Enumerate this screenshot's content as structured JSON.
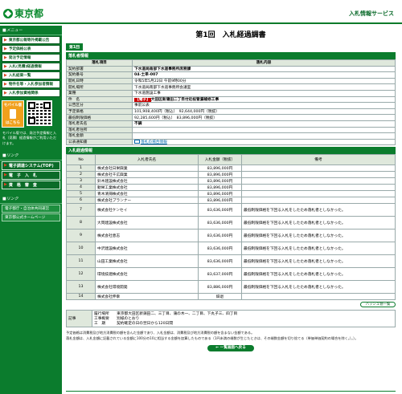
{
  "header": {
    "logo_text": "東京都",
    "service": "入札情報サービス"
  },
  "sidebar": {
    "menu_head": "■メニュー",
    "items": [
      "東京都公報等外掲載公告",
      "予定価格公表",
      "発注予定情報",
      "入札(見積)経過情報",
      "入札結果一覧",
      "物件名等・入札参加者情報",
      "入札参加資格関係"
    ],
    "mobile_label": "モバイル版",
    "mobile_sub": "はこちら",
    "mobile_note": "モバイル版では、発注予定情報と入札（見積）経過情報がご利用いただけます。",
    "link_head": "■リンク",
    "big_items": [
      "電子調達システム(TOP)",
      "電　子　入　札",
      "資　格　審　査"
    ],
    "ext_head": "■リンク",
    "ext_links": [
      "電子都庁・自治体共同運営",
      "東京都公式ホームページ"
    ]
  },
  "page": {
    "title": "第1回　入札経過調書",
    "round_tab": "第1回"
  },
  "info": {
    "section": "落札者情報",
    "col_item": "落札項目",
    "col_content": "落札内容",
    "rows": [
      {
        "label": "契約部署",
        "value": "下水道局南部下水道事務所庶務課",
        "bold": true
      },
      {
        "label": "契約番号",
        "value": "04-土単-007",
        "bold": true
      },
      {
        "label": "開札日時",
        "value": "令和5年5月22日 午前9時00分"
      },
      {
        "label": "開札場所",
        "value": "下水道局南部下水道事務所会議室"
      },
      {
        "label": "業種",
        "value": "下水道施設工事"
      },
      {
        "label": "件　名",
        "tag": "【電子】",
        "value": "大田区新蒲田二丁目付近枝管漏補修工事",
        "bold": true
      },
      {
        "label": "公告区分",
        "value": "事前公表"
      },
      {
        "label": "予定価格",
        "value": "101,908,400円（税込）　92,644,000円（税抜）"
      },
      {
        "label": "最低制限価格",
        "value": "92,285,600円（税込）　83,896,000円（税抜）"
      },
      {
        "label": "落札者氏名",
        "value": "不調",
        "bold": true
      },
      {
        "label": "落札者住所",
        "value": ""
      },
      {
        "label": "落札金額",
        "value": ""
      },
      {
        "label": "公表通知書",
        "value": "落札の場合情報",
        "link": true
      }
    ]
  },
  "result": {
    "section": "入札経過情報",
    "col_no": "No",
    "col_name": "入札者氏名",
    "col_amount": "入札金額（税抜）",
    "col_note": "備考",
    "rows": [
      {
        "no": "1",
        "name": "株式会社日栄興業",
        "amount": "83,896,000円",
        "note": ""
      },
      {
        "no": "2",
        "name": "株式会社千広興業",
        "amount": "83,896,000円",
        "note": ""
      },
      {
        "no": "3",
        "name": "鈴木建設株式会社",
        "amount": "83,896,000円",
        "note": ""
      },
      {
        "no": "4",
        "name": "動栄工業株式会社",
        "amount": "83,896,000円",
        "note": ""
      },
      {
        "no": "5",
        "name": "青木清掃株式会社",
        "amount": "83,896,000円",
        "note": ""
      },
      {
        "no": "6",
        "name": "株式会社プランナー",
        "amount": "83,896,000円",
        "note": ""
      },
      {
        "no": "7",
        "name": "株式会社ケンセイ",
        "amount": "83,636,000円",
        "note": "最低制限価格を下回る入札をしたため落札者としなかった。",
        "tall": true
      },
      {
        "no": "8",
        "name": "大岡建設株式会社",
        "amount": "83,636,000円",
        "note": "最低制限価格を下回る入札をしたため落札者としなかった。",
        "tall": true
      },
      {
        "no": "9",
        "name": "株式会社恵志",
        "amount": "83,636,000円",
        "note": "最低制限価格を下回る入札をしたため落札者としなかった。",
        "tall": true
      },
      {
        "no": "10",
        "name": "中沢建設株式会社",
        "amount": "83,636,000円",
        "note": "最低制限価格を下回る入札をしたため落札者としなかった。",
        "tall": true
      },
      {
        "no": "11",
        "name": "山田工業株式会社",
        "amount": "83,636,000円",
        "note": "最低制限価格を下回る入札をしたため落札者としなかった。",
        "tall": true
      },
      {
        "no": "12",
        "name": "環境技建株式会社",
        "amount": "83,637,000円",
        "note": "最低制限価格を下回る入札をしたため落札者としなかった。",
        "tall": true
      },
      {
        "no": "13",
        "name": "株式会社環境開発",
        "amount": "83,886,000円",
        "note": "最低制限価格を下回る入札をしたため落札者としなかった。",
        "tall": true
      },
      {
        "no": "14",
        "name": "株式会社伸幸",
        "amount": "辞退",
        "note": ""
      }
    ]
  },
  "ext_button": "ハッシュ値一覧",
  "memo": {
    "label": "記事",
    "lines": [
      "履行場所　　東京都大田区新蒲田二、三丁目、蒲の木一、二丁目、下丸子三、四丁目",
      "工事概要　　別紙のとおり",
      "工　期　　　契約確定の日の翌日から120日間"
    ]
  },
  "notes": [
    "予定価格は消費税及び地方消費税の額を含んだ金額であり、入札金額は、消費税及び地方消費税の額を含まない金額である。",
    "落札金額は、入札金額に記載されている金額に100分の10に相当する金額を加算したものである（1円未満の端数が生じたときは、その端数金額を切り捨てる（単価単価契約の場合を除く。）。）。"
  ],
  "back_button": "← 一覧画面へ戻る"
}
